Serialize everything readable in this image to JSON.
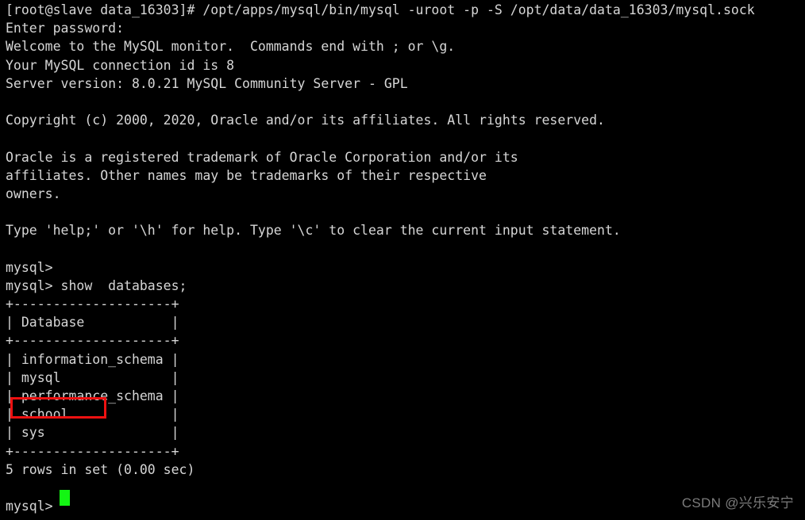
{
  "window": {
    "kind": "terminal",
    "title": "MySQL monitor session",
    "background_color": "#000000",
    "foreground_color": "#d6d6d6"
  },
  "terminal": {
    "lines": [
      "[root@slave data_16303]# /opt/apps/mysql/bin/mysql -uroot -p -S /opt/data/data_16303/mysql.sock",
      "Enter password:",
      "Welcome to the MySQL monitor.  Commands end with ; or \\g.",
      "Your MySQL connection id is 8",
      "Server version: 8.0.21 MySQL Community Server - GPL",
      "",
      "Copyright (c) 2000, 2020, Oracle and/or its affiliates. All rights reserved.",
      "",
      "Oracle is a registered trademark of Oracle Corporation and/or its",
      "affiliates. Other names may be trademarks of their respective",
      "owners.",
      "",
      "Type 'help;' or '\\h' for help. Type '\\c' to clear the current input statement.",
      "",
      "mysql>",
      "mysql> show  databases;",
      "+--------------------+",
      "| Database           |",
      "+--------------------+",
      "| information_schema |",
      "| mysql              |",
      "| performance_schema |",
      "| school             |",
      "| sys                |",
      "+--------------------+",
      "5 rows in set (0.00 sec)",
      "",
      "mysql> "
    ],
    "command_entered": "show  databases;",
    "prompt": "mysql>",
    "shell_prompt": "[root@slave data_16303]#",
    "login_command": "/opt/apps/mysql/bin/mysql -uroot -p -S /opt/data/data_16303/mysql.sock",
    "password_prompt": "Enter password:",
    "connection_id": "8",
    "server_version": "8.0.21 MySQL Community Server - GPL",
    "result_summary": "5 rows in set (0.00 sec)",
    "cursor_color": "#13f513"
  },
  "databases_table": {
    "column_header": "Database",
    "rows": [
      "information_schema",
      "mysql",
      "performance_schema",
      "school",
      "sys"
    ],
    "row_count": 5,
    "border_line": "+--------------------+"
  },
  "annotation": {
    "highlighted_value": "school",
    "shape": "rectangle",
    "color": "#ee1111",
    "border_width_px": 3
  },
  "watermark": {
    "text": "CSDN @兴乐安宁",
    "color": "#7c7c7c"
  }
}
